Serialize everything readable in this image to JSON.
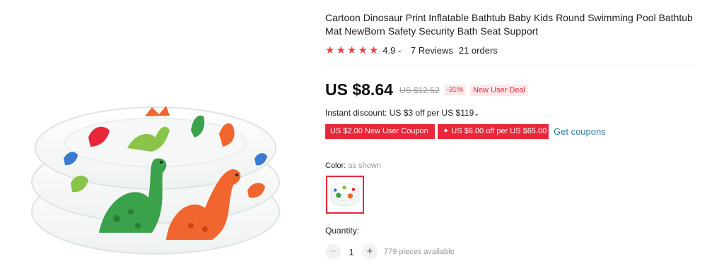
{
  "product": {
    "title": "Cartoon Dinosaur Print Inflatable Bathtub Baby Kids Round Swimming Pool Bathtub Mat NewBorn Safety Security Bath Seat Support",
    "image_icon": "inflatable-pool-dinosaur-image"
  },
  "rating": {
    "stars": 5,
    "value": "4.9",
    "chevron": "⌄",
    "reviews": "7 Reviews",
    "orders": "21 orders",
    "star_color": "#f0404a"
  },
  "price": {
    "current": "US $8.64",
    "original": "US $12.52",
    "discount": "-31%",
    "deal": "New User Deal"
  },
  "instant_discount": {
    "text": "Instant discount: US $3 off per US $119",
    "chevron": "⌄"
  },
  "coupons": {
    "coupon1": "US $2.00 New User Coupon",
    "coupon2": "✦ US $6.00 off per US $65.00",
    "get_link": "Get coupons"
  },
  "color": {
    "label": "Color:",
    "value": "as shown"
  },
  "quantity": {
    "label": "Quantity:",
    "minus": "−",
    "plus": "+",
    "value": "1",
    "available": "779 pieces available"
  },
  "colors": {
    "accent": "#e8283a",
    "link": "#2e7a95",
    "muted": "#999999"
  }
}
